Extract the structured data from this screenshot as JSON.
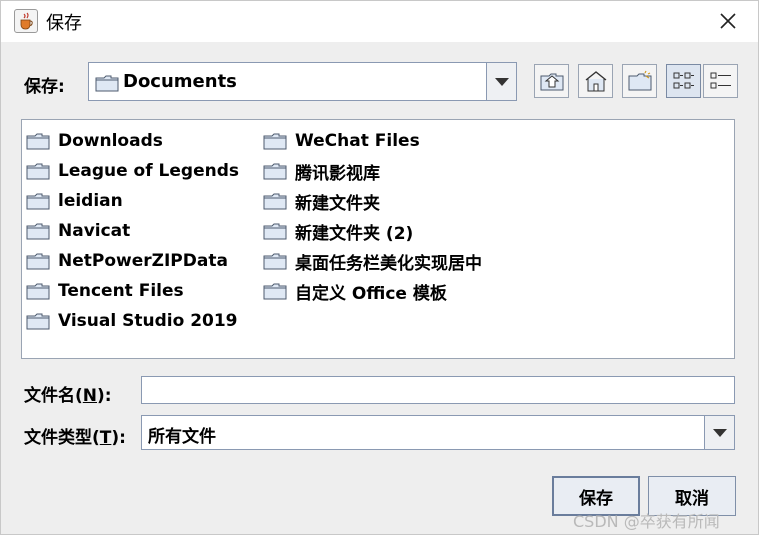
{
  "window": {
    "title": "保存",
    "icon": "java-cup-icon",
    "close_icon": "close-icon"
  },
  "save_in": {
    "label": "保存:",
    "value": "Documents"
  },
  "toolbar": {
    "icons": [
      "up-one-level-icon",
      "home-icon",
      "new-folder-icon",
      "list-view-icon",
      "details-view-icon"
    ]
  },
  "files": {
    "column1": [
      "Downloads",
      "League of Legends",
      "leidian",
      "Navicat",
      "NetPowerZIPData",
      "Tencent Files",
      "Visual Studio 2019"
    ],
    "column2": [
      "WeChat Files",
      "腾讯影视库",
      "新建文件夹",
      "新建文件夹 (2)",
      "桌面任务栏美化实现居中",
      "自定义 Office 模板"
    ]
  },
  "filename": {
    "label_pre": "文件名(",
    "label_mn": "N",
    "label_post": "):",
    "value": ""
  },
  "filetype": {
    "label_pre": "文件类型(",
    "label_mn": "T",
    "label_post": "):",
    "value": "所有文件"
  },
  "buttons": {
    "save": "保存",
    "cancel": "取消"
  },
  "watermark": "CSDN @卒获有所闻",
  "colors": {
    "folder_fill": "#dfe8f4",
    "folder_stroke": "#4c5a6e",
    "button_bg": "#e9edf3",
    "border": "#8a99b2"
  }
}
